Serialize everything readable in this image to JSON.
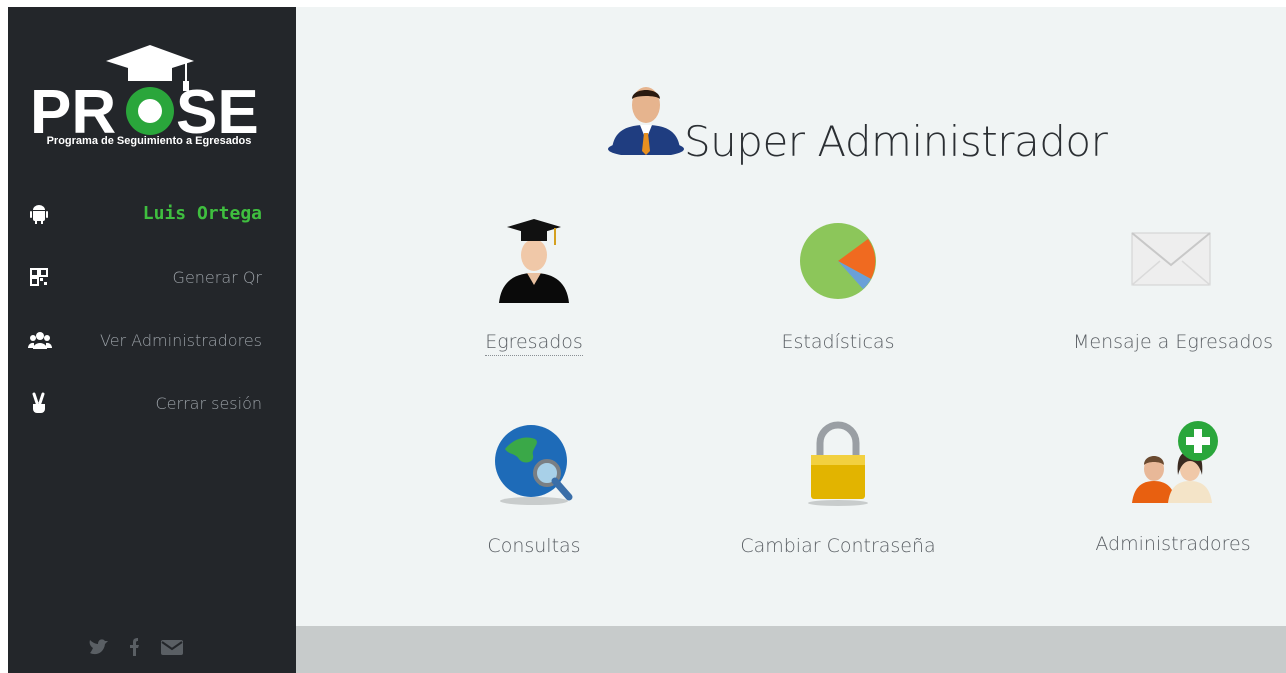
{
  "sidebar": {
    "logo": {
      "text": "PROSE",
      "subtitle": "Programa de Seguimiento a Egresados"
    },
    "user": {
      "label": "Luis Ortega",
      "icon": "android-icon"
    },
    "items": [
      {
        "label": "Generar Qr",
        "icon": "qr-code-icon"
      },
      {
        "label": "Ver Administradores",
        "icon": "users-icon"
      },
      {
        "label": "Cerrar sesión",
        "icon": "peace-hand-icon"
      }
    ],
    "social": [
      "twitter-icon",
      "facebook-icon",
      "mail-icon"
    ]
  },
  "main": {
    "title": "Super Administrador",
    "tiles": [
      {
        "label": "Egresados",
        "icon": "graduate-icon"
      },
      {
        "label": "Estadísticas",
        "icon": "pie-chart-icon"
      },
      {
        "label": "Mensaje a Egresados",
        "icon": "envelope-icon"
      },
      {
        "label": "Consultas",
        "icon": "globe-search-icon"
      },
      {
        "label": "Cambiar Contraseña",
        "icon": "padlock-icon"
      },
      {
        "label": "Administradores",
        "icon": "add-admin-icon"
      }
    ]
  },
  "colors": {
    "sidebar_bg": "#23262a",
    "accent_green": "#3fbf3f",
    "main_bg": "#f0f4f4",
    "footer_bg": "#c7cbcb"
  }
}
